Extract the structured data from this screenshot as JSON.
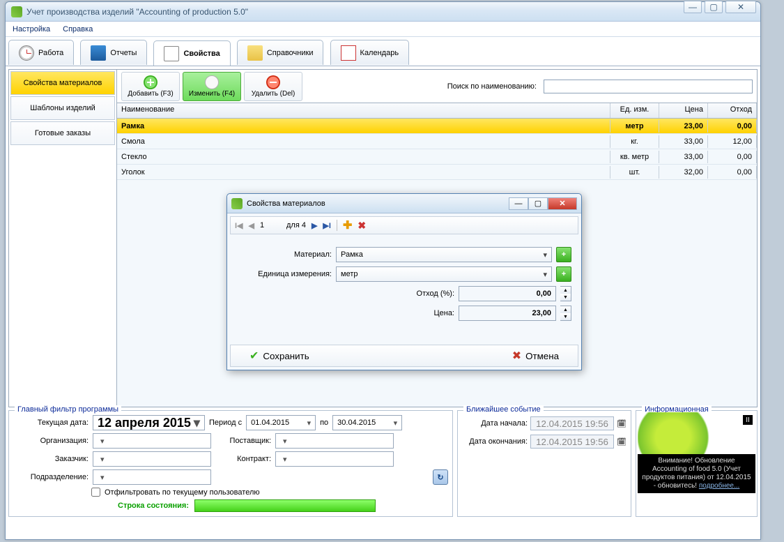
{
  "window": {
    "title": "Учет производства изделий \"Accounting of production 5.0\""
  },
  "menu": {
    "settings": "Настройка",
    "help": "Справка"
  },
  "tabs": [
    {
      "label": "Работа"
    },
    {
      "label": "Отчеты"
    },
    {
      "label": "Свойства"
    },
    {
      "label": "Справочники"
    },
    {
      "label": "Календарь"
    }
  ],
  "sidebar": {
    "items": [
      "Свойства материалов",
      "Шаблоны изделий",
      "Готовые заказы"
    ]
  },
  "toolbar": {
    "add": "Добавить (F3)",
    "edit": "Изменить (F4)",
    "del": "Удалить (Del)",
    "search_label": "Поиск по наименованию:"
  },
  "grid": {
    "headers": {
      "name": "Наименование",
      "unit": "Ед. изм.",
      "price": "Цена",
      "waste": "Отход"
    },
    "rows": [
      {
        "name": "Рамка",
        "unit": "метр",
        "price": "23,00",
        "waste": "0,00"
      },
      {
        "name": "Смола",
        "unit": "кг.",
        "price": "33,00",
        "waste": "12,00"
      },
      {
        "name": "Стекло",
        "unit": "кв. метр",
        "price": "33,00",
        "waste": "0,00"
      },
      {
        "name": "Уголок",
        "unit": "шт.",
        "price": "32,00",
        "waste": "0,00"
      }
    ]
  },
  "dialog": {
    "title": "Свойства материалов",
    "nav": {
      "pos": "1",
      "of": "для 4"
    },
    "fields": {
      "material_label": "Материал:",
      "material_value": "Рамка",
      "unit_label": "Единица измерения:",
      "unit_value": "метр",
      "waste_label": "Отход (%):",
      "waste_value": "0,00",
      "price_label": "Цена:",
      "price_value": "23,00"
    },
    "actions": {
      "save": "Сохранить",
      "cancel": "Отмена"
    }
  },
  "filter": {
    "title": "Главный фильтр программы",
    "current_date_label": "Текущая дата:",
    "current_date": "12  апреля  2015",
    "period_label": "Период с",
    "date_from": "01.04.2015",
    "to": "по",
    "date_to": "30.04.2015",
    "org_label": "Организация:",
    "supplier_label": "Поставщик:",
    "customer_label": "Заказчик:",
    "contract_label": "Контракт:",
    "dept_label": "Подразделение:",
    "filter_user": "Отфильтровать по текущему пользователю",
    "status_label": "Строка состояния:"
  },
  "event": {
    "title": "Ближайшее событие",
    "start_label": "Дата начала:",
    "start_value": "12.04.2015 19:56",
    "end_label": "Дата окончания:",
    "end_value": "12.04.2015 19:56"
  },
  "info": {
    "title": "Информационная",
    "text": "Внимание! Обновление Accounting of food 5.0 (Учет продуктов питания) от 12.04.2015 - обновитесь!",
    "link": "подробнее..."
  }
}
